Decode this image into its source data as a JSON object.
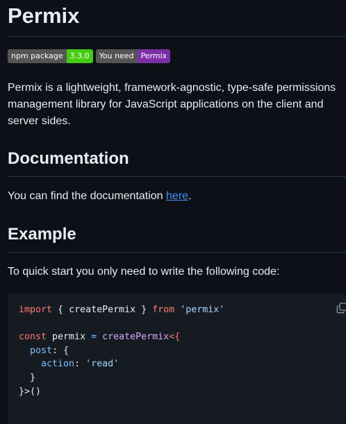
{
  "page": {
    "title": "Permix",
    "badges": [
      {
        "left": "npm package",
        "right": "3.3.0",
        "right_color": "#44cc11"
      },
      {
        "left": "You need",
        "right": "Permix",
        "right_color": "#7b2fa6"
      }
    ],
    "intro": "Permix is a lightweight, framework-agnostic, type-safe permissions management library for JavaScript applications on the client and server sides.",
    "documentation": {
      "heading": "Documentation",
      "text_before": "You can find the documentation ",
      "link": "here",
      "text_after": "."
    },
    "example": {
      "heading": "Example",
      "text": "To quick start you only need to write the following code:",
      "code": {
        "l1_kw": "import",
        "l1_mid": " { createPermix } ",
        "l1_from": "from",
        "l1_str": "'permix'",
        "l3_kw": "const",
        "l3_name": " permix ",
        "l3_eq": "=",
        "l3_fn": "createPermix",
        "l3_gen": "<{",
        "l4_prop": "post",
        "l4_rest": ": {",
        "l5_prop": "action",
        "l5_colon": ": ",
        "l5_str": "'read'",
        "l6": "}",
        "l7": "}>()"
      },
      "copy_icon": "copy-icon"
    }
  }
}
